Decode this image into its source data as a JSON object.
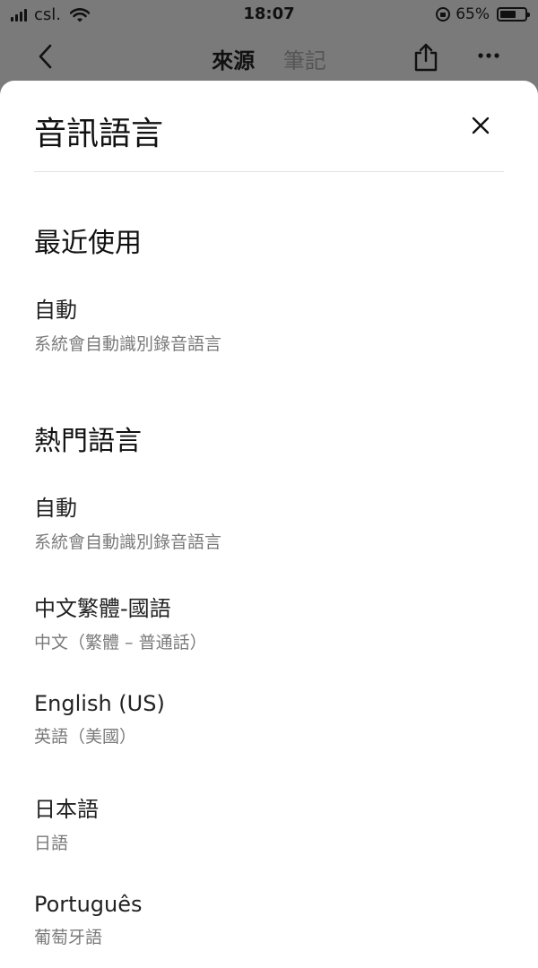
{
  "status_bar": {
    "carrier": "csl.",
    "time": "18:07",
    "battery_percent_label": "65%",
    "battery_level": 0.65
  },
  "nav": {
    "tabs": [
      {
        "label": "來源",
        "active": true
      },
      {
        "label": "筆記",
        "active": false
      }
    ]
  },
  "sheet": {
    "title": "音訊語言",
    "recent": {
      "title": "最近使用",
      "items": [
        {
          "name": "自動",
          "desc": "系統會自動識別錄音語言"
        }
      ]
    },
    "popular": {
      "title": "熱門語言",
      "items": [
        {
          "name": "自動",
          "desc": "系統會自動識別錄音語言"
        },
        {
          "name": "中文繁體-國語",
          "desc": "中文（繁體 – 普通話）"
        },
        {
          "name": "English (US)",
          "desc": "英語（美國）"
        },
        {
          "name": "日本語",
          "desc": "日語"
        },
        {
          "name": "Português",
          "desc": "葡萄牙語"
        }
      ]
    }
  },
  "icons": {
    "back": "chevron-left-icon",
    "share": "share-icon",
    "more": "more-icon",
    "close": "close-icon",
    "wifi": "wifi-icon",
    "signal": "signal-icon",
    "lock": "orientation-lock-icon",
    "battery": "battery-icon"
  }
}
